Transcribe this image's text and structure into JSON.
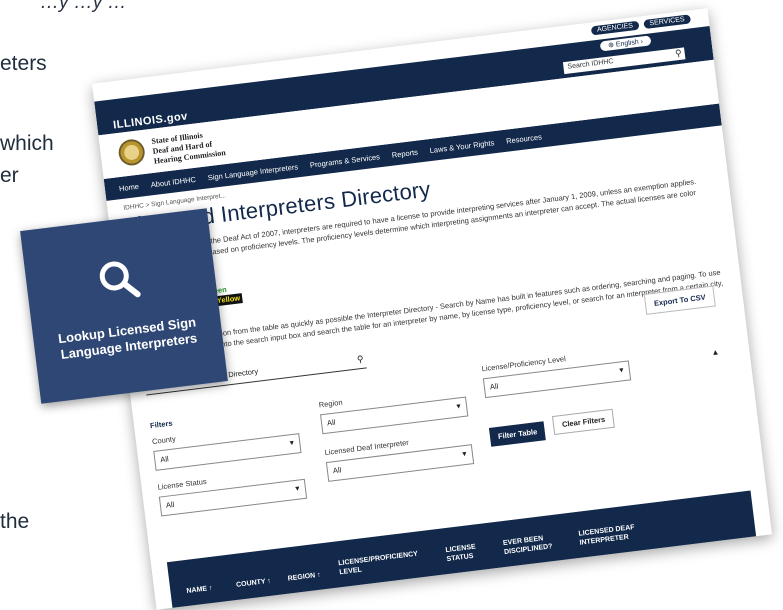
{
  "slide": {
    "fragments": [
      "…y …y …",
      "eters",
      "which",
      "er",
      "the"
    ]
  },
  "site": {
    "utility": {
      "agencies": "AGENCIES",
      "services": "SERVICES"
    },
    "language": "English",
    "state_logo": "ILLINOIS.gov",
    "search_placeholder": "Search IDHHC",
    "agency_name": "State of Illinois\nDeaf and Hard of\nHearing Commission",
    "nav": [
      "Home",
      "About IDHHC",
      "Sign Language Interpreters",
      "Programs & Services",
      "Reports",
      "Laws & Your Rights",
      "Resources"
    ],
    "breadcrumb": "IDHHC  >  Sign Language Interpret..."
  },
  "main": {
    "title": "Licensed Interpreters Directory",
    "intro": "Under the Interpreter for the Deaf Act of 2007, interpreters are required to have a license to provide interpreting services after January 1, 2009, unless an exemption applies. Interpreter licenses are based on proficiency levels. The proficiency levels determine which interpreting assignments an interpreter can accept. The actual licenses are color coded:",
    "levels": {
      "silver": "General-Master: Silver",
      "green": "General-Advanced: Green",
      "yellow": "General-Intermediate: Yellow",
      "red": "Provisional: Red"
    },
    "instructions": "To obtain useful information from the table as quickly as possible the Interpreter Directory - Search by Name has built in features such as ordering, searching and paging. To use the search feature type into the search input box and search the table for an interpreter by name, by license type, proficiency level, or search for an interpreter from a certain city, county or region.",
    "export_label": "Export To CSV",
    "directory_search_placeholder": "Search within Interpreter Directory"
  },
  "filters": {
    "heading": "Filters",
    "county": {
      "label": "County",
      "value": "All"
    },
    "region": {
      "label": "Region",
      "value": "All"
    },
    "license_level": {
      "label": "License/Proficiency Level",
      "value": "All"
    },
    "license_status": {
      "label": "License Status",
      "value": "All"
    },
    "deaf_interpreter": {
      "label": "Licensed Deaf Interpreter",
      "value": "All"
    },
    "filter_button": "Filter Table",
    "clear_button": "Clear Filters"
  },
  "table": {
    "columns": [
      "NAME",
      "COUNTY",
      "REGION",
      "LICENSE/PROFICIENCY LEVEL",
      "LICENSE STATUS",
      "EVER BEEN DISCIPLINED?",
      "LICENSED DEAF INTERPRETER"
    ]
  },
  "card": {
    "icon": "search-icon",
    "label": "Lookup Licensed Sign\nLanguage Interpreters"
  },
  "colors": {
    "navy": "#13294b",
    "card": "#2f4775"
  }
}
